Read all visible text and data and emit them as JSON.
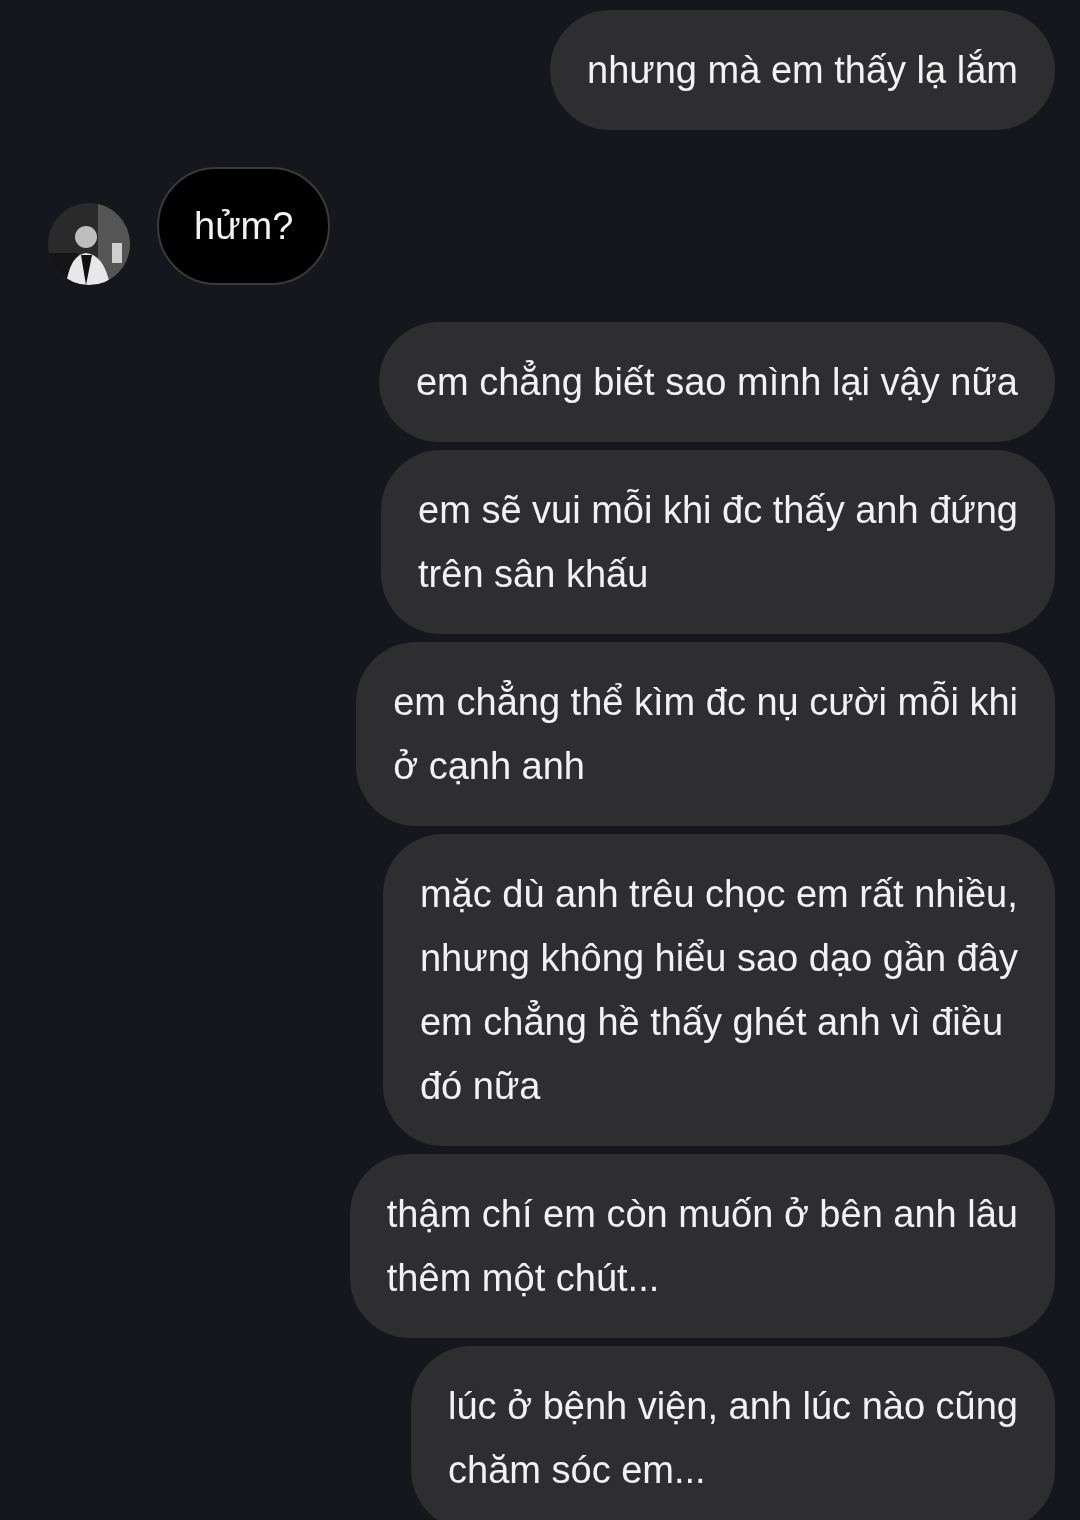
{
  "messages": [
    {
      "kind": "outgoing",
      "lines": [
        "nhưng mà em thấy lạ lắm"
      ]
    },
    {
      "kind": "incoming",
      "avatar": {
        "kind": "picture"
      },
      "lines": [
        "hửm?"
      ]
    },
    {
      "kind": "outgoing",
      "lines": [
        "em chẳng biết sao mình lại vậy nữa"
      ]
    },
    {
      "kind": "outgoing",
      "lines": [
        "em sẽ vui mỗi khi đc thấy anh đứng",
        "trên sân khấu"
      ]
    },
    {
      "kind": "outgoing",
      "lines": [
        "em chẳng thể kìm đc nụ cười mỗi khi",
        "ở cạnh anh"
      ]
    },
    {
      "kind": "outgoing",
      "lines": [
        "mặc dù anh trêu chọc em rất nhiều,",
        "nhưng không hiểu sao dạo gần đây",
        "em chẳng hề thấy ghét anh vì điều",
        "đó nữa"
      ]
    },
    {
      "kind": "outgoing",
      "lines": [
        "thậm chí em còn muốn ở bên anh lâu",
        "thêm một chút..."
      ]
    },
    {
      "kind": "outgoing",
      "lines": [
        "lúc ở bệnh viện, anh lúc nào cũng",
        "chăm sóc em..."
      ]
    }
  ]
}
